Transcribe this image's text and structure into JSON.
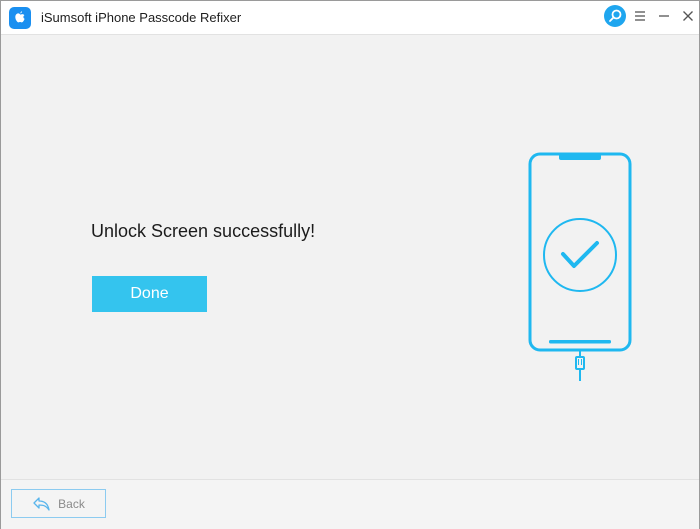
{
  "window": {
    "title": "iSumsoft iPhone Passcode Refixer"
  },
  "titlebar": {
    "icons": [
      "apple-icon",
      "search-icon",
      "menu-icon",
      "minimize-icon",
      "close-icon"
    ]
  },
  "main": {
    "message": "Unlock Screen successfully!",
    "done_label": "Done",
    "illustration_icon": "phone-check-icon"
  },
  "footer": {
    "back_label": "Back",
    "back_icon": "back-arrow-icon"
  },
  "colors": {
    "accent": "#34c4ee",
    "phone_stroke": "#1fb8f0",
    "search_bg": "#1fa6ef",
    "back_border": "#8ccbf0",
    "background": "#f2f2f2"
  }
}
